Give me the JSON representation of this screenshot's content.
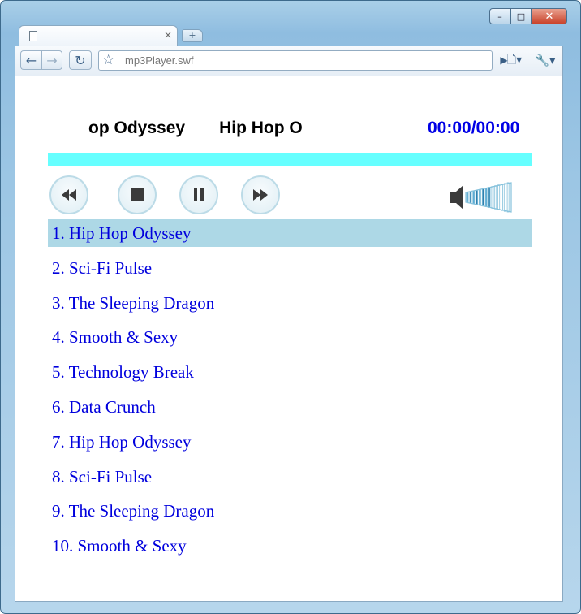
{
  "browser": {
    "tab_close": "×",
    "new_tab": "+",
    "address": "mp3Player.swf",
    "window_controls": {
      "minimize": "–",
      "maximize": "□",
      "close": "✕"
    }
  },
  "player": {
    "now_playing_marquee": [
      "op Odyssey",
      "Hip Hop O"
    ],
    "time": "00:00/00:00",
    "progress": 0,
    "volume": 0.6,
    "colors": {
      "progress": "#66ffff",
      "time": "#0000e6",
      "track_text": "#0000dd",
      "active_row": "#add8e6"
    },
    "controls": [
      "rewind-icon",
      "stop-icon",
      "pause-icon",
      "fast-forward-icon"
    ]
  },
  "playlist": [
    "1. Hip Hop Odyssey",
    "2. Sci-Fi Pulse",
    "3. The Sleeping Dragon",
    "4. Smooth & Sexy",
    "5. Technology Break",
    "6. Data Crunch",
    "7. Hip Hop Odyssey",
    "8. Sci-Fi Pulse",
    "9. The Sleeping Dragon",
    "10. Smooth & Sexy"
  ],
  "active_track": 0
}
